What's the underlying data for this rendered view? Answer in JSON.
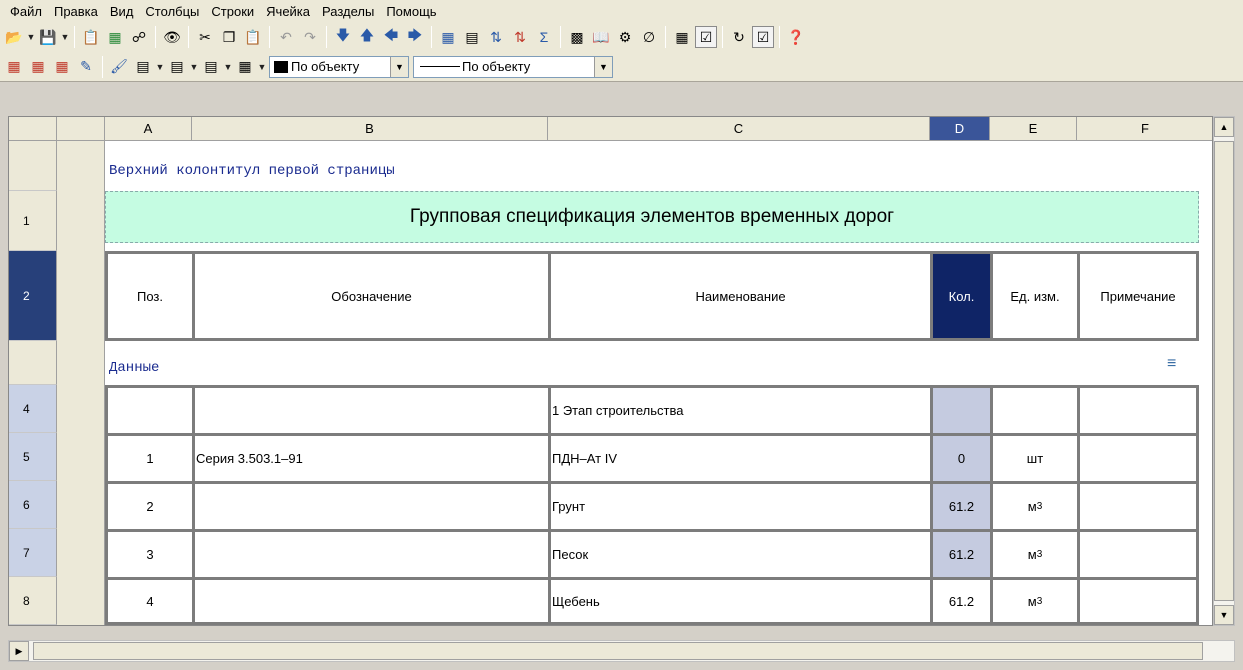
{
  "menu": [
    "Файл",
    "Правка",
    "Вид",
    "Столбцы",
    "Строки",
    "Ячейка",
    "Разделы",
    "Помощь"
  ],
  "toolbar": {
    "row1_icons": [
      "open-folder-icon",
      "save-icon",
      "copy-format-icon",
      "insert-icon",
      "link-icon",
      "view-icon",
      "cut-icon",
      "copy-icon",
      "paste-icon",
      "undo-icon",
      "redo-icon",
      "move-down-icon",
      "move-up-icon",
      "move-left-icon",
      "move-right-icon",
      "table-icon",
      "sheet-icon",
      "sort-asc-icon",
      "sort-desc-icon",
      "sum-icon",
      "calculator-icon",
      "book-icon",
      "properties-icon",
      "empty-set-icon",
      "calc-sheet-icon",
      "checkbox-icon",
      "refresh-icon",
      "check-icon",
      "help-icon"
    ],
    "fill_combo": "По объекту",
    "line_combo": "По объекту"
  },
  "grid": {
    "columns": [
      "A",
      "B",
      "C",
      "D",
      "E",
      "F"
    ],
    "selected_column": "D",
    "header_section": "Верхний колонтитул первой страницы",
    "data_section": "Данные",
    "title": "Групповая спецификация элементов временных дорог",
    "header_row": {
      "row": "2",
      "cells": [
        "Поз.",
        "Обозначение",
        "Наименование",
        "Кол.",
        "Ед. изм.",
        "Примечание"
      ]
    },
    "title_row": "1",
    "rows": [
      {
        "row": "4",
        "pos": "",
        "designation": "",
        "name": "1 Этап строительства",
        "qty": "",
        "unit": "",
        "note": ""
      },
      {
        "row": "5",
        "pos": "1",
        "designation": "Серия 3.503.1–91",
        "name": "ПДН–Ат IV",
        "qty": "0",
        "unit": "шт",
        "note": ""
      },
      {
        "row": "6",
        "pos": "2",
        "designation": "",
        "name": "Грунт",
        "qty": "61.2",
        "unit": "м",
        "unit_sup": "3",
        "note": ""
      },
      {
        "row": "7",
        "pos": "3",
        "designation": "",
        "name": "Песок",
        "qty": "61.2",
        "unit": "м",
        "unit_sup": "3",
        "note": ""
      },
      {
        "row": "8",
        "pos": "4",
        "designation": "",
        "name": "Щебень",
        "qty": "61.2",
        "unit": "м",
        "unit_sup": "3",
        "note": ""
      }
    ]
  }
}
